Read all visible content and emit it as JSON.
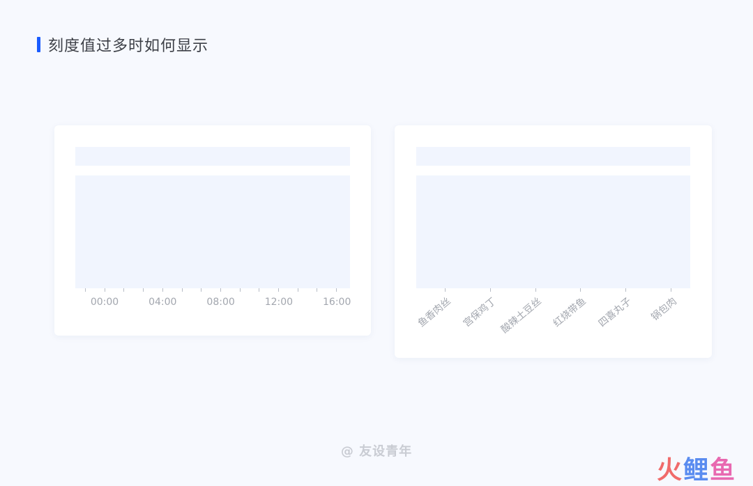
{
  "section_title": "刻度值过多时如何显示",
  "left_card": {
    "tick_count": 14,
    "tick_labels": [
      "00:00",
      "04:00",
      "08:00",
      "12:00",
      "16:00"
    ]
  },
  "right_card": {
    "categories": [
      "鱼香肉丝",
      "宫保鸡丁",
      "酸辣土豆丝",
      "红烧带鱼",
      "四喜丸子",
      "锅包肉"
    ]
  },
  "watermark": "@ 友设青年",
  "logo": {
    "chars": [
      "火",
      "鲤",
      "鱼"
    ],
    "colors": [
      "#f06b6b",
      "#5a8cf0",
      "#e868b0"
    ]
  },
  "colors": {
    "accent": "#1a5cff",
    "background": "#f7f9fe",
    "placeholder": "#f1f5fe",
    "label": "#a2a6ae"
  }
}
